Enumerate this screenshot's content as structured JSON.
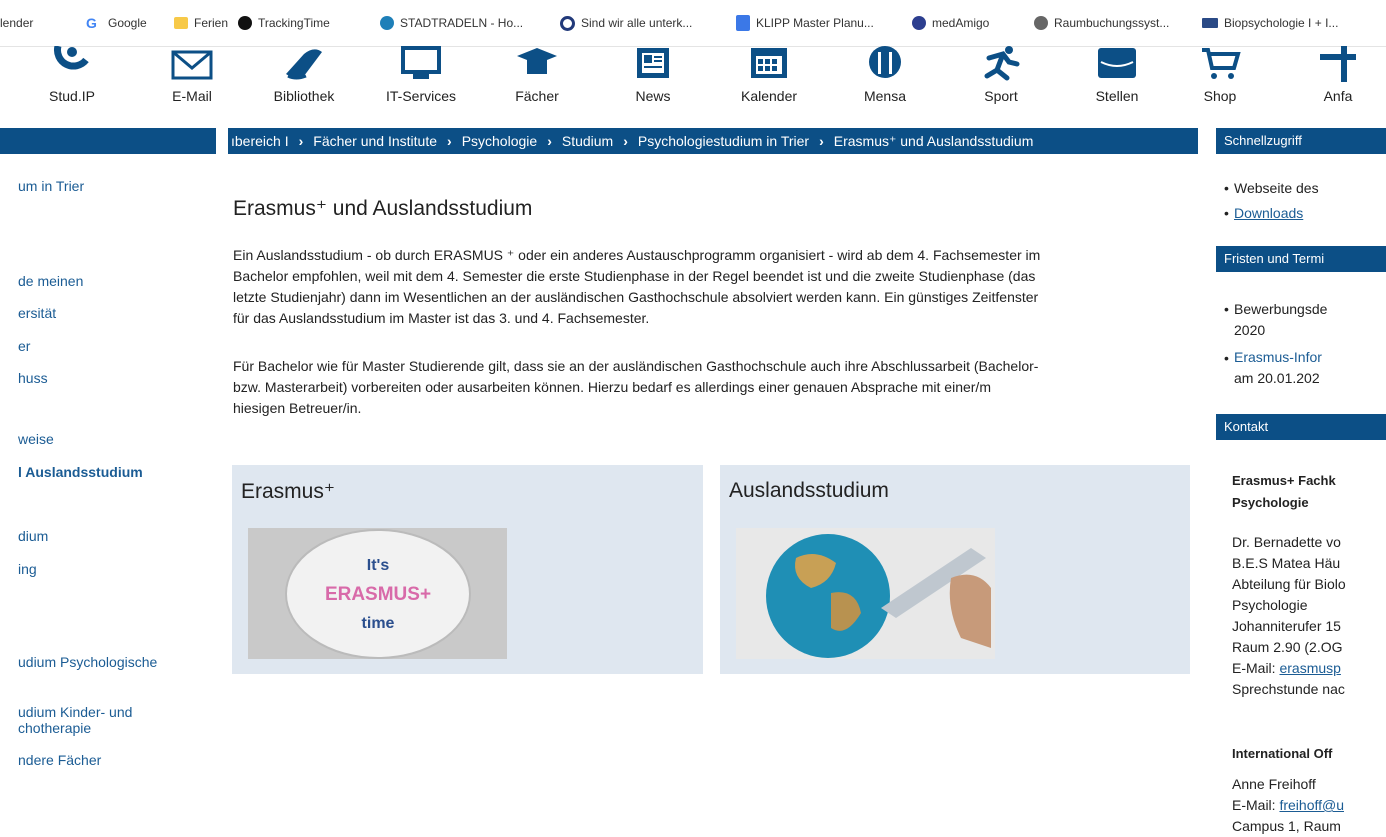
{
  "bookmarks": [
    {
      "label": "lender",
      "icon": "calendar-icon"
    },
    {
      "label": "Google",
      "icon": "google-icon"
    },
    {
      "label": "Ferien",
      "icon": "folder-icon"
    },
    {
      "label": "TrackingTime",
      "icon": "trackingtime-icon"
    },
    {
      "label": "STADTRADELN - Ho...",
      "icon": "stadtradeln-icon"
    },
    {
      "label": "Sind wir alle unterk...",
      "icon": "target-icon"
    },
    {
      "label": "KLIPP Master Planu...",
      "icon": "doc-icon"
    },
    {
      "label": "medAmigo",
      "icon": "medamigo-icon"
    },
    {
      "label": "Raumbuchungssyst...",
      "icon": "globe-icon"
    },
    {
      "label": "Biopsychologie I + I...",
      "icon": "ilias-icon"
    }
  ],
  "nav": [
    {
      "label": "Stud.IP",
      "icon": "studip-icon"
    },
    {
      "label": "E-Mail",
      "icon": "mail-icon"
    },
    {
      "label": "Bibliothek",
      "icon": "book-icon"
    },
    {
      "label": "IT-Services",
      "icon": "monitor-icon"
    },
    {
      "label": "Fächer",
      "icon": "graduation-cap-icon"
    },
    {
      "label": "News",
      "icon": "newspaper-icon"
    },
    {
      "label": "Kalender",
      "icon": "calendar-grid-icon"
    },
    {
      "label": "Mensa",
      "icon": "cutlery-icon"
    },
    {
      "label": "Sport",
      "icon": "running-icon"
    },
    {
      "label": "Stellen",
      "icon": "briefcase-icon"
    },
    {
      "label": "Shop",
      "icon": "cart-icon"
    },
    {
      "label": "Anfa",
      "icon": "signpost-icon"
    }
  ],
  "left_nav": [
    "um in Trier",
    "de meinen",
    "ersität",
    "er",
    "huss",
    "weise",
    "l Auslandsstudium",
    "dium",
    "ing",
    "udium Psychologische",
    "udium Kinder- und",
    "chotherapie",
    "ndere Fächer"
  ],
  "breadcrumb": [
    "ıbereich I",
    "Fächer und Institute",
    "Psychologie",
    "Studium",
    "Psychologiestudium in Trier",
    "Erasmus⁺ und Auslandsstudium"
  ],
  "main": {
    "title": "Erasmus⁺ und Auslandsstudium",
    "para1": [
      "Ein Auslandsstudium - ob durch ERASMUS ⁺ oder ein anderes Austauschprogramm organisiert - wird ab dem 4. Fachsemester im",
      "Bachelor empfohlen, weil mit dem 4. Semester die erste Studienphase in der Regel beendet ist und die zweite Studienphase (das",
      "letzte Studienjahr) dann im Wesentlichen an der ausländischen Gasthochschule absolviert werden kann. Ein günstiges Zeitfenster",
      "für das Auslandsstudium im Master ist das 3. und 4. Fachsemester."
    ],
    "para2": [
      "Für Bachelor wie für Master Studierende gilt, dass sie an der ausländischen Gasthochschule auch ihre Abschlussarbeit (Bachelor-",
      "bzw. Masterarbeit) vorbereiten oder ausarbeiten können. Hierzu bedarf es allerdings einer genauen Absprache mit einer/m",
      "hiesigen Betreuer/in."
    ],
    "cards": [
      {
        "title": "Erasmus⁺",
        "badge": [
          "It's",
          "ERASMUS+",
          "time"
        ]
      },
      {
        "title": "Auslandsstudium"
      }
    ]
  },
  "right": {
    "quick_title": "Schnellzugriff",
    "quick_items": [
      "Webseite des",
      "Downloads"
    ],
    "deadlines_title": "Fristen und Termi",
    "deadline_items": [
      [
        "Bewerbungsde",
        "2020"
      ],
      [
        "Erasmus-Infor",
        "am 20.01.202"
      ]
    ],
    "contact_title": "Kontakt",
    "contact_head": [
      "Erasmus+ Fachk",
      "Psychologie"
    ],
    "contact_lines": [
      "Dr. Bernadette vo",
      "B.E.S Matea Häu",
      "Abteilung für Biolo",
      "Psychologie",
      "Johanniterufer 15",
      "Raum 2.90 (2.OG"
    ],
    "contact_email_label": "E-Mail: ",
    "contact_email": "erasmusp",
    "contact_hours": "Sprechstunde nac",
    "office_title": "International Off",
    "office_name": "Anne Freihoff",
    "office_email_label": "E-Mail: ",
    "office_email": "freihoff@u",
    "office_room": "Campus 1, Raum"
  },
  "colors": {
    "brand_blue": "#0c4f86",
    "link": "#1b5c94",
    "card_bg": "#dfe7f0"
  }
}
